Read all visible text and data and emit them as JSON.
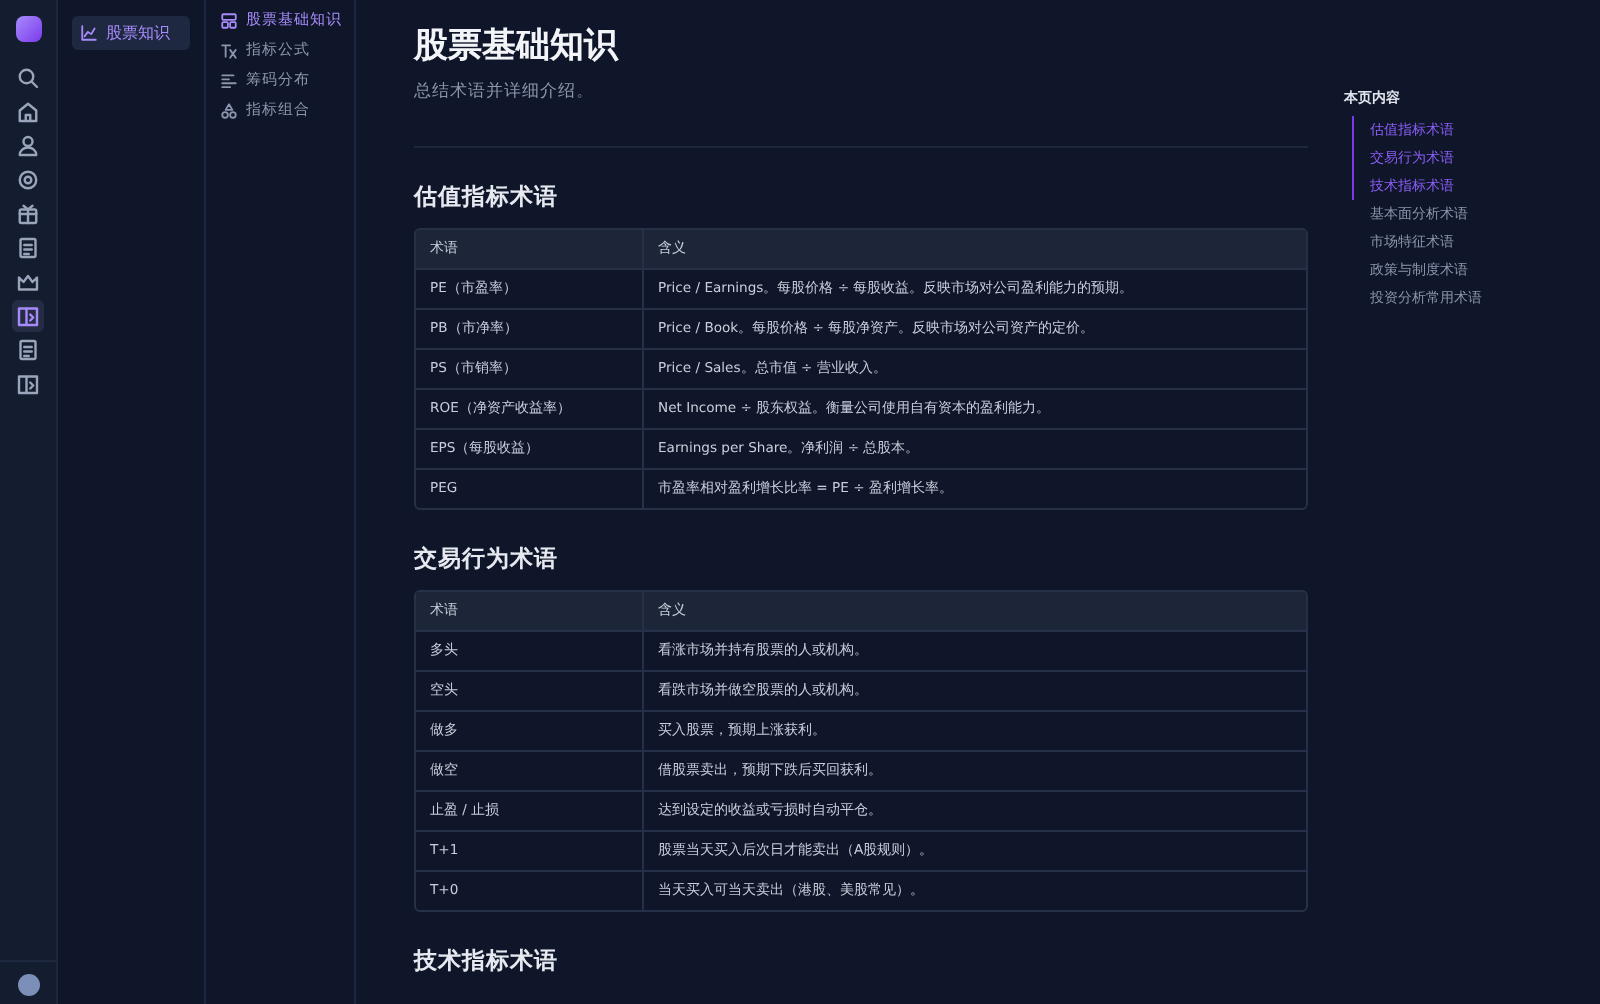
{
  "rail": {
    "items": [
      {
        "kind": "search",
        "selected": false
      },
      {
        "kind": "home",
        "selected": false
      },
      {
        "kind": "user",
        "selected": false
      },
      {
        "kind": "gear",
        "selected": false
      },
      {
        "kind": "box",
        "selected": false
      },
      {
        "kind": "doc",
        "selected": false
      },
      {
        "kind": "crown",
        "selected": false
      },
      {
        "kind": "book",
        "selected": true
      },
      {
        "kind": "doc",
        "selected": false
      },
      {
        "kind": "book",
        "selected": false
      }
    ]
  },
  "sidebar": {
    "items": [
      {
        "label": "股票知识",
        "selected": true
      }
    ]
  },
  "subnav": {
    "items": [
      {
        "label": "股票基础知识",
        "kind": "grid",
        "selected": true
      },
      {
        "label": "指标公式",
        "kind": "tex",
        "selected": false
      },
      {
        "label": "筹码分布",
        "kind": "bars",
        "selected": false
      },
      {
        "label": "指标组合",
        "kind": "triangle",
        "selected": false
      }
    ]
  },
  "page": {
    "title": "股票基础知识",
    "subtitle": "总结术语并详细介绍。"
  },
  "sections": [
    {
      "heading": "估值指标术语",
      "columns": [
        "术语",
        "含义"
      ],
      "rows": [
        [
          "PE（市盈率）",
          "Price / Earnings。每股价格 ÷ 每股收益。反映市场对公司盈利能力的预期。"
        ],
        [
          "PB（市净率）",
          "Price / Book。每股价格 ÷ 每股净资产。反映市场对公司资产的定价。"
        ],
        [
          "PS（市销率）",
          "Price / Sales。总市值 ÷ 营业收入。"
        ],
        [
          "ROE（净资产收益率）",
          "Net Income ÷ 股东权益。衡量公司使用自有资本的盈利能力。"
        ],
        [
          "EPS（每股收益）",
          "Earnings per Share。净利润 ÷ 总股本。"
        ],
        [
          "PEG",
          "市盈率相对盈利增长比率 = PE ÷ 盈利增长率。"
        ]
      ]
    },
    {
      "heading": "交易行为术语",
      "columns": [
        "术语",
        "含义"
      ],
      "rows": [
        [
          "多头",
          "看涨市场并持有股票的人或机构。"
        ],
        [
          "空头",
          "看跌市场并做空股票的人或机构。"
        ],
        [
          "做多",
          "买入股票，预期上涨获利。"
        ],
        [
          "做空",
          "借股票卖出，预期下跌后买回获利。"
        ],
        [
          "止盈 / 止损",
          "达到设定的收益或亏损时自动平仓。"
        ],
        [
          "T+1",
          "股票当天买入后次日才能卖出（A股规则）。"
        ],
        [
          "T+0",
          "当天买入可当天卖出（港股、美股常见）。"
        ]
      ]
    },
    {
      "heading": "技术指标术语"
    }
  ],
  "toc": {
    "title": "本页内容",
    "items": [
      {
        "label": "估值指标术语",
        "active": true
      },
      {
        "label": "交易行为术语",
        "active": true
      },
      {
        "label": "技术指标术语",
        "active": true
      },
      {
        "label": "基本面分析术语",
        "active": false
      },
      {
        "label": "市场特征术语",
        "active": false
      },
      {
        "label": "政策与制度术语",
        "active": false
      },
      {
        "label": "投资分析常用术语",
        "active": false
      }
    ]
  }
}
